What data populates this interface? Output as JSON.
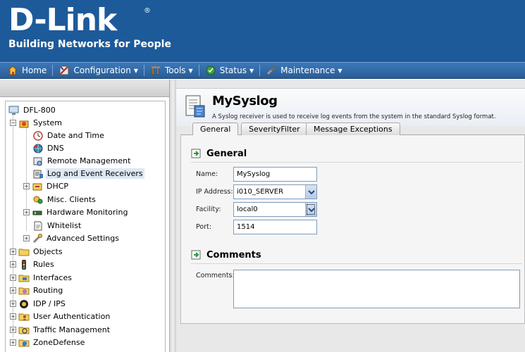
{
  "brand": {
    "logo_text": "D-Link",
    "registered_mark": "®",
    "tagline": "Building Networks for People",
    "header_color": "#1d5a9a"
  },
  "menubar": {
    "items": [
      {
        "label": "Home",
        "icon": "home-icon",
        "has_dropdown": false
      },
      {
        "label": "Configuration",
        "icon": "configuration-icon",
        "has_dropdown": true
      },
      {
        "label": "Tools",
        "icon": "tools-icon",
        "has_dropdown": true
      },
      {
        "label": "Status",
        "icon": "status-icon",
        "has_dropdown": true
      },
      {
        "label": "Maintenance",
        "icon": "maintenance-icon",
        "has_dropdown": true
      }
    ]
  },
  "tree": {
    "root": "DFL-800",
    "system": {
      "label": "System",
      "children": [
        {
          "label": "Date and Time",
          "icon": "clock-icon"
        },
        {
          "label": "DNS",
          "icon": "dns-icon"
        },
        {
          "label": "Remote Management",
          "icon": "remote-management-icon"
        },
        {
          "label": "Log and Event Receivers",
          "icon": "log-receivers-icon",
          "selected": true
        },
        {
          "label": "DHCP",
          "icon": "dhcp-icon",
          "expandable": true
        },
        {
          "label": "Misc. Clients",
          "icon": "misc-clients-icon"
        },
        {
          "label": "Hardware Monitoring",
          "icon": "hardware-monitoring-icon",
          "expandable": true
        },
        {
          "label": "Whitelist",
          "icon": "whitelist-icon"
        },
        {
          "label": "Advanced Settings",
          "icon": "advanced-settings-icon",
          "expandable": true
        }
      ]
    },
    "top_level": [
      {
        "label": "Objects",
        "icon": "folder-icon"
      },
      {
        "label": "Rules",
        "icon": "rules-icon"
      },
      {
        "label": "Interfaces",
        "icon": "interfaces-icon"
      },
      {
        "label": "Routing",
        "icon": "routing-icon"
      },
      {
        "label": "IDP / IPS",
        "icon": "idp-ips-icon"
      },
      {
        "label": "User Authentication",
        "icon": "user-authentication-icon"
      },
      {
        "label": "Traffic Management",
        "icon": "traffic-management-icon"
      },
      {
        "label": "ZoneDefense",
        "icon": "zonedefense-icon"
      }
    ]
  },
  "page": {
    "title": "MySyslog",
    "description": "A Syslog receiver is used to receive log events from the system in the standard Syslog format.",
    "tabs": [
      {
        "label": "General",
        "active": true
      },
      {
        "label": "SeverityFilter",
        "active": false
      },
      {
        "label": "Message Exceptions",
        "active": false
      }
    ]
  },
  "general_section": {
    "heading": "General",
    "name_label": "Name:",
    "name_value": "MySyslog",
    "ip_label": "IP Address:",
    "ip_value": "i010_SERVER",
    "facility_label": "Facility:",
    "facility_value": "local0",
    "port_label": "Port:",
    "port_value": "1514"
  },
  "comments_section": {
    "heading": "Comments",
    "comments_label": "Comments:",
    "comments_value": ""
  }
}
